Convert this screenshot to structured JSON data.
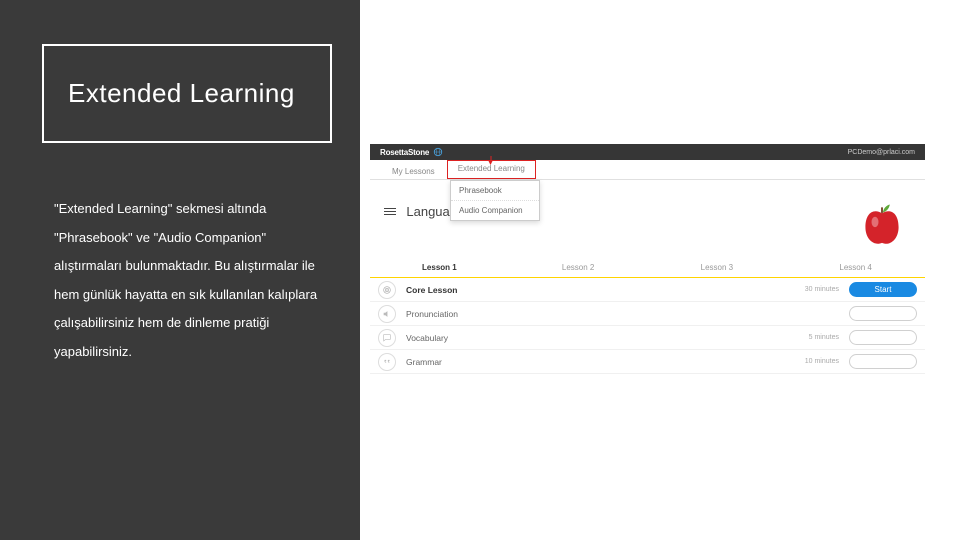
{
  "sidebar": {
    "title": "Extended Learning",
    "description": "\"Extended Learning\" sekmesi altında \"Phrasebook\" ve \"Audio Companion\" alıştırmaları bulunmaktadır. Bu alıştırmalar ile hem günlük hayatta en sık kullanılan kalıplara çalışabilirsiniz hem de dinleme pratiği yapabilirsiniz."
  },
  "app": {
    "brand": "RosettaStone",
    "user": "PCDemo@prlaci.com",
    "tabs": {
      "my_lessons": "My Lessons",
      "extended": "Extended Learning"
    },
    "dropdown": {
      "phrasebook": "Phrasebook",
      "audio": "Audio Companion"
    },
    "page_title": "Language Basics",
    "lessons": {
      "l1": "Lesson 1",
      "l2": "Lesson 2",
      "l3": "Lesson 3",
      "l4": "Lesson 4"
    },
    "rows": {
      "core": {
        "name": "Core Lesson",
        "time": "30 minutes",
        "btn": "Start"
      },
      "pron": {
        "name": "Pronunciation",
        "time": "",
        "btn": ""
      },
      "vocab": {
        "name": "Vocabulary",
        "time": "5 minutes",
        "btn": ""
      },
      "gram": {
        "name": "Grammar",
        "time": "10 minutes",
        "btn": ""
      }
    }
  }
}
